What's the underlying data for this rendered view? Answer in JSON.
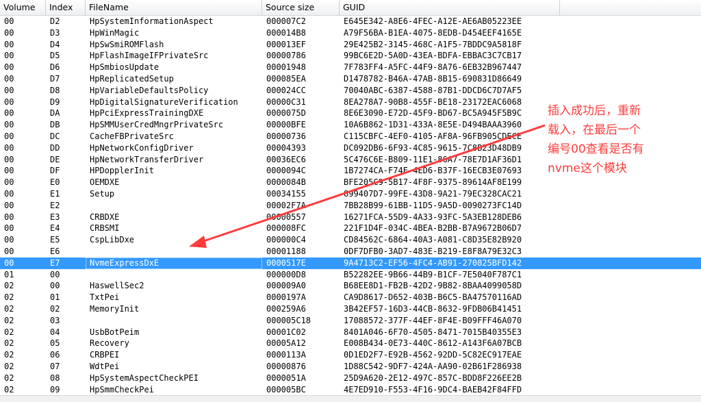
{
  "columns": [
    "Volume",
    "Index",
    "FileName",
    "Source size",
    "GUID"
  ],
  "rows": [
    [
      "00",
      "D2",
      "HpSystemInformationAspect",
      "000007C2",
      "E645E342-A8E6-4FEC-A12E-AE6AB05223EE"
    ],
    [
      "00",
      "D3",
      "HpWinMagic",
      "000014B8",
      "A79F56BA-B1EA-4075-8EDB-D454EEF4165E"
    ],
    [
      "00",
      "D4",
      "HpSwSmiROMFlash",
      "000013EF",
      "29E425B2-3145-468C-A1F5-7BDDC9A5818F"
    ],
    [
      "00",
      "D5",
      "HpFlashImageIFPrivateSrc",
      "00000786",
      "99BC6E2D-5A0D-43EA-BDFA-EBBAC3C7CB17"
    ],
    [
      "00",
      "D6",
      "HpSmbiosUpdate",
      "00001948",
      "7F783FF4-A5FC-44F9-8A76-6EB32B967447"
    ],
    [
      "00",
      "D7",
      "HpReplicatedSetup",
      "000085EA",
      "D1478782-B46A-47AB-8B15-690831D86649"
    ],
    [
      "00",
      "D8",
      "HpVariableDefaultsPolicy",
      "000024CC",
      "70040ABC-6387-4588-87B1-DDCD6C7D7AF5"
    ],
    [
      "00",
      "D9",
      "HpDigitalSignatureVerification",
      "00000C31",
      "8EA278A7-90B8-455F-BE18-23172EAC6068"
    ],
    [
      "00",
      "DA",
      "HpPciExpressTrainingDXE",
      "0000075D",
      "8E6E3090-E72D-45F9-BD67-BC5A945F5B9C"
    ],
    [
      "00",
      "DB",
      "HpSMMUserCredMngrPrivateSrc",
      "00000BFE",
      "10A6B862-1D31-433A-8E5E-D494BAAA3960"
    ],
    [
      "00",
      "DC",
      "CacheFBPrivateSrc",
      "00000736",
      "C115CBFC-4EF0-4105-AF8A-96FB905CDECE"
    ],
    [
      "00",
      "DD",
      "HpNetworkConfigDriver",
      "00004393",
      "DC092DB6-6F93-4C85-9615-7C8B23D48DB9"
    ],
    [
      "00",
      "DE",
      "HpNetworkTransferDriver",
      "00036EC6",
      "5C476C6E-B809-11E1-86A7-78E7D1AF36D1"
    ],
    [
      "00",
      "DF",
      "HPDopplerInit",
      "0000094C",
      "1B7274CA-F74E-4ED6-B37F-16ECB3E07693"
    ],
    [
      "00",
      "E0",
      "OEMDXE",
      "0000084B",
      "BFE205C9-5B17-4F8F-9375-89614AF8E199"
    ],
    [
      "00",
      "E1",
      "Setup",
      "00034155",
      "899407D7-99FE-43D8-9A21-79EC328CAC21"
    ],
    [
      "00",
      "E2",
      "",
      "00002F7A",
      "7BB28B99-61BB-11D5-9A5D-0090273FC14D"
    ],
    [
      "00",
      "E3",
      "CRBDXE",
      "00000557",
      "16271FCA-55D9-4A33-93FC-5A3EB128DEB6"
    ],
    [
      "00",
      "E4",
      "CRBSMI",
      "000008FC",
      "221F1D4F-034C-4BEA-B2BB-B7A9672B06D7"
    ],
    [
      "00",
      "E5",
      "CspLibDxe",
      "000000C4",
      "CD84562C-6864-40A3-A081-C8D35E82B920"
    ],
    [
      "00",
      "E6",
      "",
      "00001188",
      "0DF7DFB0-3AD7-483E-B219-E8F8A79E32C3"
    ],
    [
      "00",
      "E7",
      "NvmeExpressDxE",
      "0000517E",
      "9A4713C2-EF56-4FC4-AB91-270825BFD142"
    ],
    [
      "01",
      "00",
      "",
      "000000D8",
      "B52282EE-9B66-44B9-B1CF-7E5040F787C1"
    ],
    [
      "02",
      "00",
      "HaswellSec2",
      "000009A0",
      "B68EE8D1-FB2B-42D2-9B82-8BAA4099058D"
    ],
    [
      "02",
      "01",
      "TxtPei",
      "0000197A",
      "CA9D8617-D652-403B-B6C5-BA47570116AD"
    ],
    [
      "02",
      "02",
      "MemoryInit",
      "000259A6",
      "3B42EF57-16D3-44CB-8632-9FDB06B41451"
    ],
    [
      "02",
      "03",
      "",
      "000005C18",
      "17088572-377F-44EF-8F4E-B09FFF46A070"
    ],
    [
      "02",
      "04",
      "UsbBotPeim",
      "00001C02",
      "8401A046-6F70-4505-8471-7015B40355E3"
    ],
    [
      "02",
      "05",
      "Recovery",
      "00005A12",
      "E008B434-0E73-440C-8612-A143F6A07BCB"
    ],
    [
      "02",
      "06",
      "CRBPEI",
      "0000113A",
      "0D1ED2F7-E92B-4562-92DD-5C82EC917EAE"
    ],
    [
      "02",
      "07",
      "WdtPei",
      "00000876",
      "1D88C542-9DF7-424A-AA90-02B61F286938"
    ],
    [
      "02",
      "08",
      "HpSystemAspectCheckPEI",
      "0000051A",
      "25D9A620-2E12-497C-857C-BDD8F226EE2B"
    ],
    [
      "02",
      "09",
      "HpSmmCheckPei",
      "000005BC",
      "4E7ED910-F553-4F16-9DC4-BAEB42F84FFD"
    ]
  ],
  "selected_index": 21,
  "annotation": {
    "text": "插入成功后，重新\n载入，在最后一个\n编号00查看是否有\nnvme这个模块",
    "color": "#ff3b3b"
  }
}
